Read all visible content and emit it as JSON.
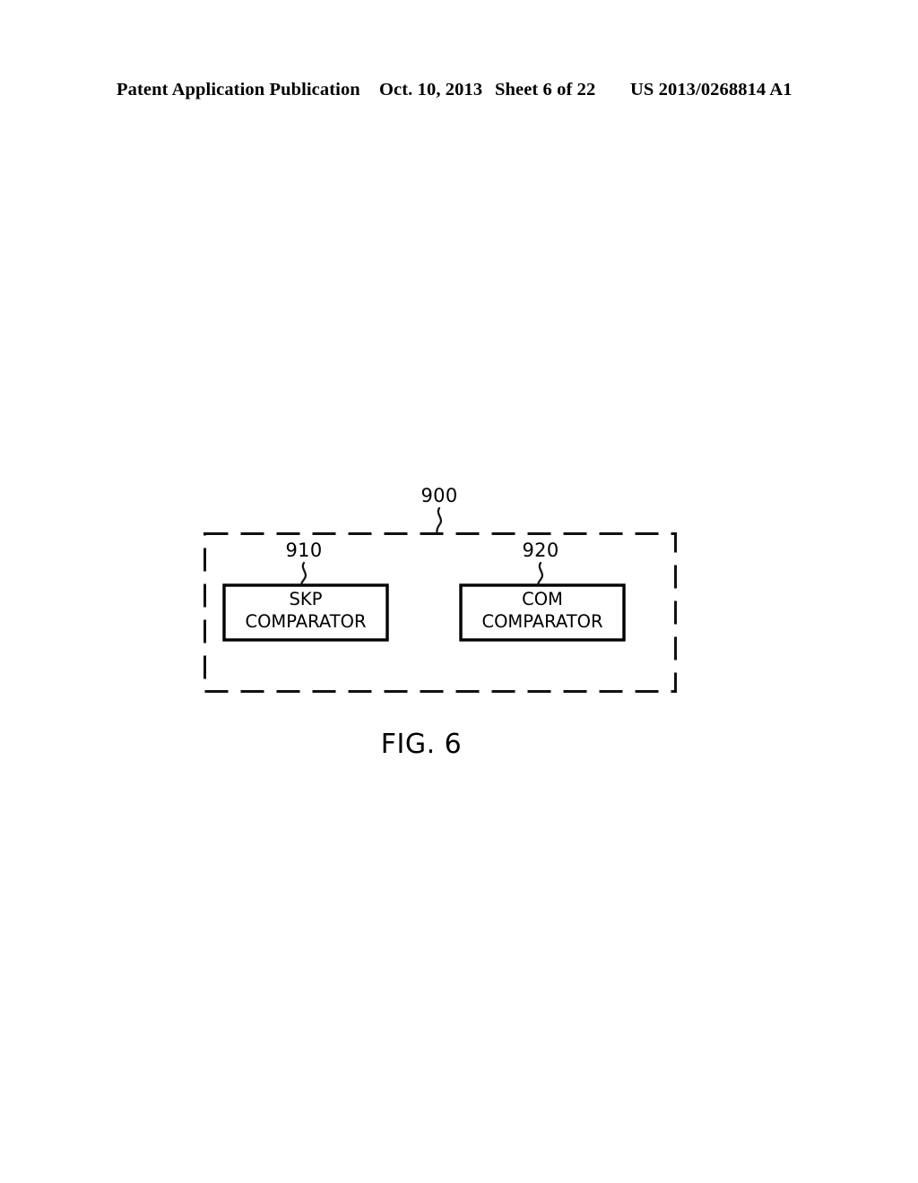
{
  "page": {
    "background_color": "#ffffff",
    "ink_color": "#000000"
  },
  "header": {
    "publication": "Patent Application Publication",
    "date": "Oct. 10, 2013",
    "sheet": "Sheet 6 of 22",
    "patent_number": "US 2013/0268814 A1"
  },
  "figure": {
    "caption": "FIG. 6",
    "container": {
      "ref": "900",
      "style": "dashed"
    },
    "blocks": [
      {
        "ref": "910",
        "label": "SKP\nCOMPARATOR",
        "line1": "SKP",
        "line2": "COMPARATOR"
      },
      {
        "ref": "920",
        "label": "COM\nCOMPARATOR",
        "line1": "COM",
        "line2": "COMPARATOR"
      }
    ]
  }
}
